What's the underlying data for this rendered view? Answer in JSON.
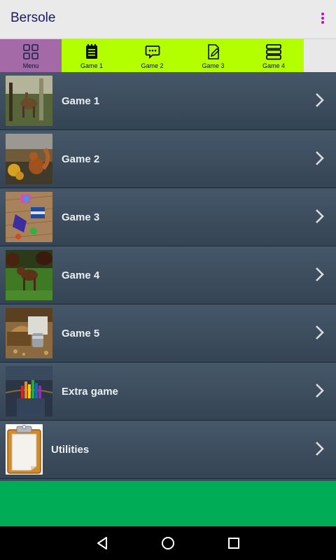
{
  "app": {
    "title": "Bersole"
  },
  "tabs": [
    {
      "label": "Menu",
      "icon": "grid-icon"
    },
    {
      "label": "Game 1",
      "icon": "notepad-icon"
    },
    {
      "label": "Game 2",
      "icon": "chat-bubble-icon"
    },
    {
      "label": "Game 3",
      "icon": "edit-document-icon"
    },
    {
      "label": "Game 4",
      "icon": "stack-icon"
    }
  ],
  "list": [
    {
      "label": "Game 1",
      "thumbnail": "garden-animal-photo"
    },
    {
      "label": "Game 2",
      "thumbnail": "squirrel-photo"
    },
    {
      "label": "Game 3",
      "thumbnail": "toys-on-wood-photo"
    },
    {
      "label": "Game 4",
      "thumbnail": "calf-on-grass-photo"
    },
    {
      "label": "Game 5",
      "thumbnail": "basket-still-life-photo"
    },
    {
      "label": "Extra game",
      "thumbnail": "pencils-in-jeans-pocket-photo"
    },
    {
      "label": "Utilities",
      "thumbnail": "clipboard-icon"
    }
  ],
  "colors": {
    "tab_active": "#a46aa8",
    "tab_inactive": "#b3ff00",
    "list_background": "#3d4c5c",
    "footer_banner": "#00ad56",
    "overflow_dots": "#c012b8"
  },
  "navigation": [
    "back-icon",
    "home-icon",
    "recents-icon"
  ]
}
